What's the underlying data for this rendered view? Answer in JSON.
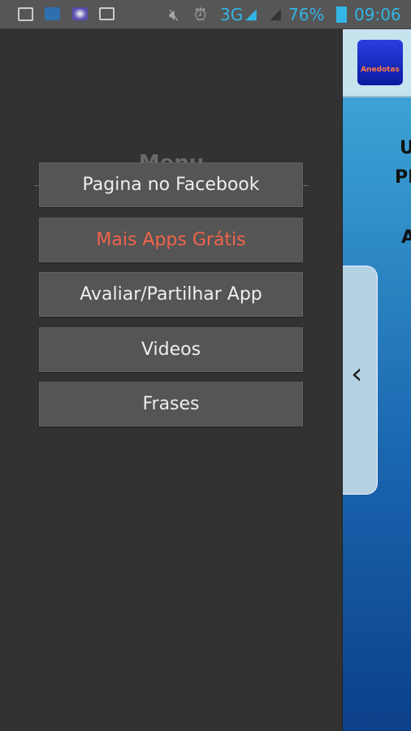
{
  "status": {
    "network": "3G",
    "sim1": "1",
    "sim2": "2",
    "battery": "76%",
    "time": "09:06",
    "icons": [
      "gallery-icon",
      "chat-icon",
      "photo-icon",
      "mail-icon",
      "mute-icon",
      "alarm-icon",
      "signal-icon",
      "signal-sim2-icon",
      "battery-icon"
    ]
  },
  "drawer": {
    "title": "Menu",
    "items": [
      {
        "label": "Pagina no Facebook",
        "color": "#eeeeee"
      },
      {
        "label": "Mais Apps Grátis",
        "color": "#f0644a"
      },
      {
        "label": "Avaliar/Partilhar App",
        "color": "#eeeeee"
      },
      {
        "label": "Videos",
        "color": "#eeeeee"
      },
      {
        "label": "Frases",
        "color": "#eeeeee"
      }
    ]
  },
  "app": {
    "logo_text": "Anedotas",
    "fragments": [
      "U",
      "PR",
      "A"
    ]
  }
}
